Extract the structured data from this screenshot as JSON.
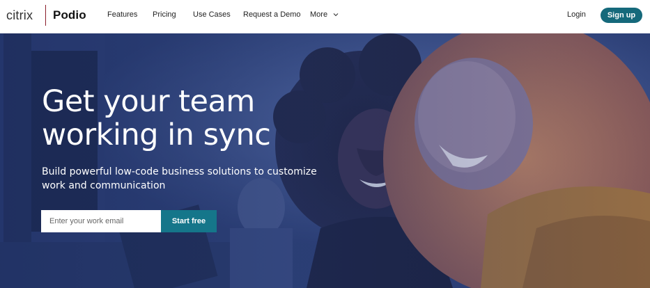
{
  "brand": {
    "citrix": "citrix",
    "product": "Podio",
    "divider_color": "#8a1d2a"
  },
  "nav": {
    "items": [
      {
        "label": "Features"
      },
      {
        "label": "Pricing"
      },
      {
        "label": "Use Cases"
      },
      {
        "label": "Request a Demo"
      },
      {
        "label": "More"
      }
    ],
    "more_icon": "chevron-down-icon",
    "login_label": "Login",
    "signup_label": "Sign up"
  },
  "hero": {
    "title": "Get your team working in sync",
    "subtitle": "Build powerful low-code business solutions to customize work and communication",
    "email_placeholder": "Enter your work email",
    "cta_label": "Start free"
  },
  "colors": {
    "accent": "#15697b",
    "hero_tint": "#2b3d73"
  }
}
